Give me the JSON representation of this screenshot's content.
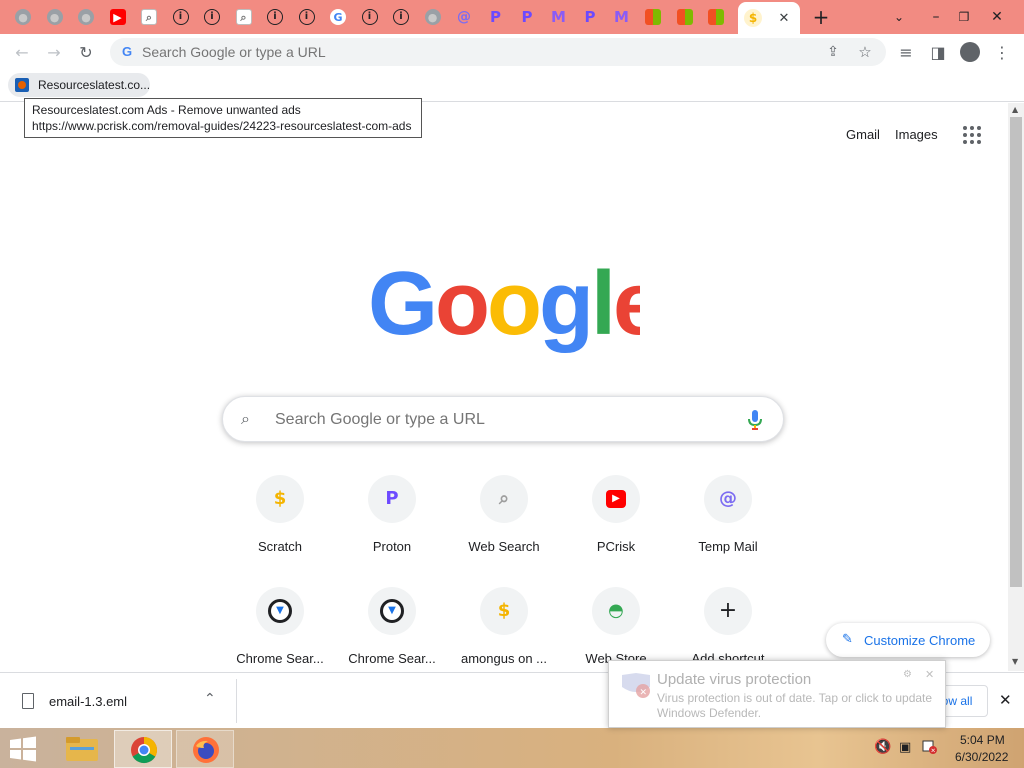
{
  "tabs": [
    {
      "icon": "globe-icon",
      "color": "#9aa0a6",
      "glyph": "●"
    },
    {
      "icon": "globe-icon",
      "color": "#9aa0a6",
      "glyph": "●"
    },
    {
      "icon": "globe-icon",
      "color": "#9aa0a6",
      "glyph": "●"
    },
    {
      "icon": "youtube-icon",
      "color": "#ff0000",
      "glyph": "▶"
    },
    {
      "icon": "search-icon",
      "color": "#bdbdbd",
      "glyph": "⌕"
    },
    {
      "icon": "info-icon",
      "color": "#202124",
      "glyph": "i"
    },
    {
      "icon": "info-icon",
      "color": "#202124",
      "glyph": "i"
    },
    {
      "icon": "search-icon",
      "color": "#bdbdbd",
      "glyph": "⌕"
    },
    {
      "icon": "info-icon",
      "color": "#202124",
      "glyph": "i"
    },
    {
      "icon": "info-icon",
      "color": "#202124",
      "glyph": "i"
    },
    {
      "icon": "google-icon",
      "color": "#ffffff",
      "glyph": "G"
    },
    {
      "icon": "info-icon",
      "color": "#202124",
      "glyph": "i"
    },
    {
      "icon": "info-icon",
      "color": "#202124",
      "glyph": "i"
    },
    {
      "icon": "globe-icon",
      "color": "#9aa0a6",
      "glyph": "●"
    },
    {
      "icon": "at-icon",
      "color": "#7c6cf2",
      "glyph": "@"
    },
    {
      "icon": "proton-icon",
      "color": "#6d4aff",
      "glyph": "P"
    },
    {
      "icon": "proton-icon",
      "color": "#6d4aff",
      "glyph": "P"
    },
    {
      "icon": "mail-icon",
      "color": "#8a5cf6",
      "glyph": "M"
    },
    {
      "icon": "proton-icon",
      "color": "#6d4aff",
      "glyph": "P"
    },
    {
      "icon": "mail-icon",
      "color": "#8a5cf6",
      "glyph": "M"
    },
    {
      "icon": "microsoft-icon",
      "color": "#f25022",
      "glyph": "■"
    },
    {
      "icon": "microsoft-icon",
      "color": "#f25022",
      "glyph": "■"
    },
    {
      "icon": "microsoft-icon",
      "color": "#f25022",
      "glyph": "■"
    },
    {
      "icon": "scratch-icon",
      "color": "#f4b400",
      "glyph": "$"
    }
  ],
  "omnibox": {
    "placeholder": "Search Google or type a URL"
  },
  "bookmarks": [
    {
      "label": "Resourceslatest.co..."
    }
  ],
  "tooltip": {
    "line1": "Resourceslatest.com Ads - Remove unwanted ads",
    "line2": "https://www.pcrisk.com/removal-guides/24223-resourceslatest-com-ads"
  },
  "ntp": {
    "gmail": "Gmail",
    "images": "Images",
    "search_placeholder": "Search Google or type a URL",
    "customize": "Customize Chrome",
    "shortcuts": [
      {
        "label": "Scratch",
        "icon": "scratch-icon",
        "color": "#f4b400",
        "glyph": "$"
      },
      {
        "label": "Proton",
        "icon": "proton-icon",
        "color": "#6d4aff",
        "glyph": "P"
      },
      {
        "label": "Web Search",
        "icon": "search-icon",
        "color": "#9e9e9e",
        "glyph": "⌕"
      },
      {
        "label": "PCrisk",
        "icon": "youtube-icon",
        "color": "#ff0000",
        "glyph": "▶"
      },
      {
        "label": "Temp Mail",
        "icon": "at-icon",
        "color": "#7c6cf2",
        "glyph": "@"
      },
      {
        "label": "Chrome Sear...",
        "icon": "chrome-search-icon",
        "color": "#202124",
        "glyph": "▼"
      },
      {
        "label": "Chrome Sear...",
        "icon": "chrome-search-icon",
        "color": "#202124",
        "glyph": "▼"
      },
      {
        "label": "amongus on ...",
        "icon": "scratch-icon",
        "color": "#f4b400",
        "glyph": "$"
      },
      {
        "label": "Web Store",
        "icon": "webstore-icon",
        "color": "#34a853",
        "glyph": "◓"
      },
      {
        "label": "Add shortcut",
        "icon": "plus-icon",
        "color": "#202124",
        "glyph": "+"
      }
    ]
  },
  "downloads": {
    "file": "email-1.3.eml",
    "show_all": "Show all"
  },
  "notification": {
    "title": "Update virus protection",
    "body1": "Virus protection is out of date. Tap or click to update",
    "body2": "Windows Defender."
  },
  "taskbar": {
    "time": "5:04 PM",
    "date": "6/30/2022"
  }
}
